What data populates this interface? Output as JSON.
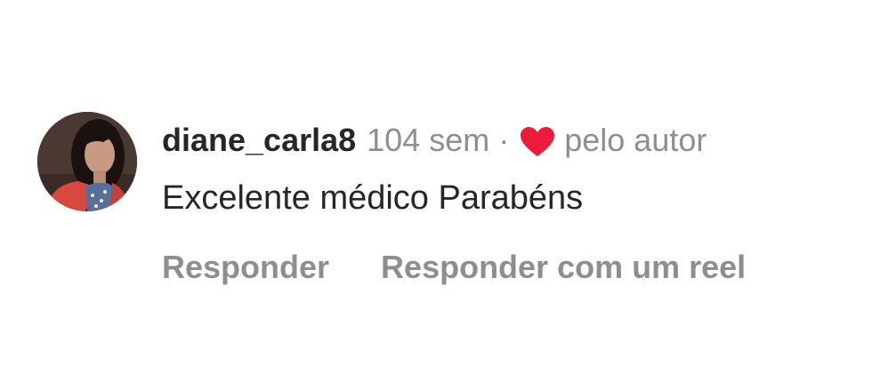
{
  "comment": {
    "username": "diane_carla8",
    "time": "104 sem",
    "separator": "·",
    "liked_by_author_label": "pelo autor",
    "text": "Excelente médico Parabéns",
    "avatar_icon": "user-photo-avatar",
    "heart_icon": "heart-icon",
    "heart_color": "#ed1c3a"
  },
  "actions": {
    "reply_label": "Responder",
    "reply_with_reel_label": "Responder com um reel"
  },
  "colors": {
    "text_primary": "#262626",
    "text_secondary": "#8e8e8e",
    "background": "#ffffff"
  }
}
